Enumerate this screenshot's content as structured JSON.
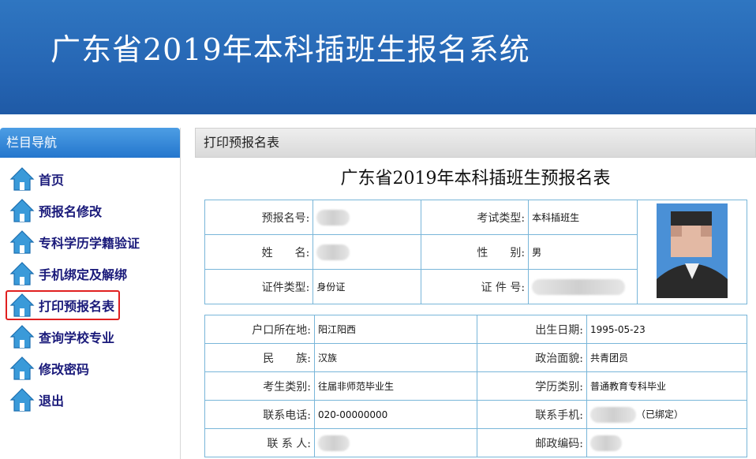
{
  "header": {
    "title": "广东省2019年本科插班生报名系统"
  },
  "sidebar": {
    "title": "栏目导航",
    "items": [
      {
        "label": "首页"
      },
      {
        "label": "预报名修改"
      },
      {
        "label": "专科学历学籍验证"
      },
      {
        "label": "手机绑定及解绑"
      },
      {
        "label": "打印预报名表"
      },
      {
        "label": "查询学校专业"
      },
      {
        "label": "修改密码"
      },
      {
        "label": "退出"
      }
    ]
  },
  "panel": {
    "title": "打印预报名表"
  },
  "form": {
    "title": "广东省2019年本科插班生预报名表",
    "top": {
      "reg_no_label": "预报名号:",
      "exam_type_label": "考试类型:",
      "exam_type": "本科插班生",
      "name_label": "姓　　名:",
      "gender_label": "性　　别:",
      "gender": "男",
      "id_type_label": "证件类型:",
      "id_type": "身份证",
      "id_no_label": "证 件 号:"
    },
    "details": {
      "hukou_label": "户口所在地:",
      "hukou": "阳江阳西",
      "birth_label": "出生日期:",
      "birth": "1995-05-23",
      "ethnic_label": "民　　族:",
      "ethnic": "汉族",
      "political_label": "政治面貌:",
      "political": "共青团员",
      "category_label": "考生类别:",
      "category": "往届非师范毕业生",
      "edu_type_label": "学历类别:",
      "edu_type": "普通教育专科毕业",
      "phone_label": "联系电话:",
      "phone": "020-00000000",
      "mobile_label": "联系手机:",
      "mobile_status": "（已绑定）",
      "contact_label": "联 系 人:",
      "postcode_label": "邮政编码:"
    }
  },
  "colors": {
    "header_blue": "#2666b4",
    "nav_text": "#1a1a7a",
    "table_border": "#79b6d9",
    "active_outline": "#e02020"
  }
}
